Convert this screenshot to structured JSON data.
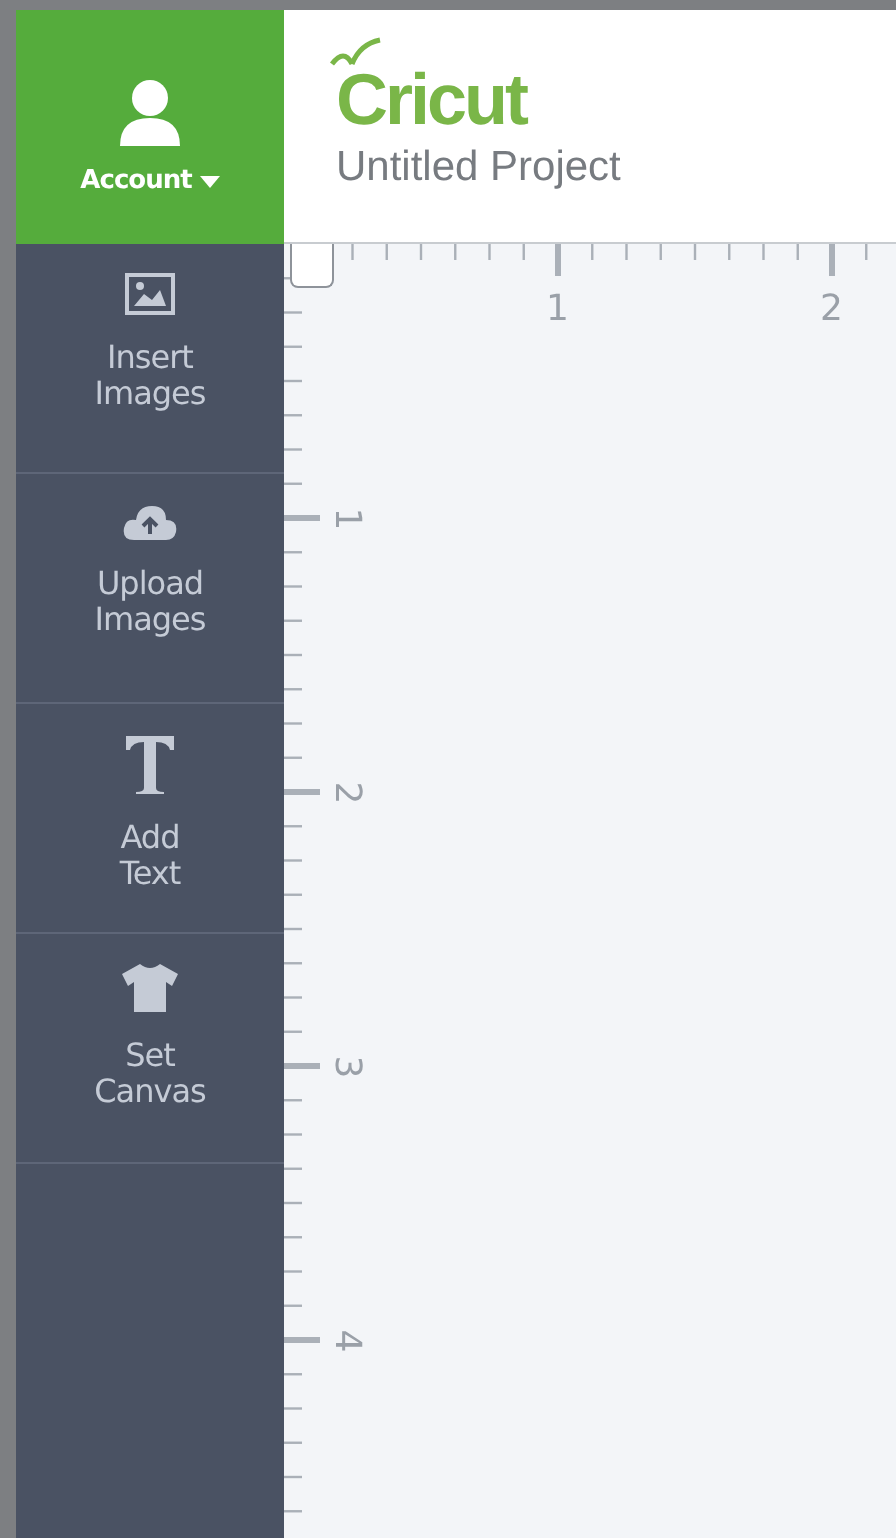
{
  "account": {
    "label": "Account"
  },
  "header": {
    "logo": "Cricut",
    "project_title": "Untitled Project"
  },
  "sidebar": {
    "items": [
      {
        "label": "Insert Images",
        "kind": "image"
      },
      {
        "label": "Upload Images",
        "kind": "upload"
      },
      {
        "label": "Add Text",
        "kind": "text"
      },
      {
        "label": "Set Canvas",
        "kind": "canvas"
      }
    ]
  },
  "ruler": {
    "horizontal_labels": [
      "1",
      "2"
    ],
    "vertical_labels": [
      "1",
      "2",
      "3",
      "4"
    ]
  }
}
